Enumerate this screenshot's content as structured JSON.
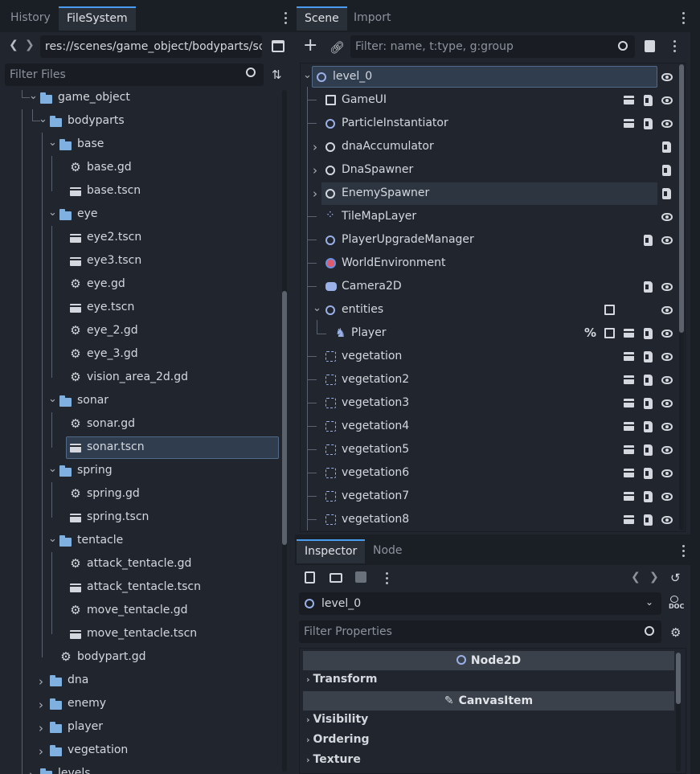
{
  "left_tabs": [
    "History",
    "FileSystem"
  ],
  "path": "res://scenes/game_object/bodyparts/so",
  "filter_files_placeholder": "Filter Files",
  "files": [
    {
      "label": "game_object",
      "type": "folder",
      "expanded": true
    },
    {
      "label": "bodyparts",
      "type": "folder",
      "expanded": true
    },
    {
      "label": "base",
      "type": "folder",
      "expanded": true
    },
    {
      "label": "base.gd",
      "type": "gd"
    },
    {
      "label": "base.tscn",
      "type": "tscn"
    },
    {
      "label": "eye",
      "type": "folder",
      "expanded": true
    },
    {
      "label": "eye2.tscn",
      "type": "tscn"
    },
    {
      "label": "eye3.tscn",
      "type": "tscn"
    },
    {
      "label": "eye.gd",
      "type": "gd"
    },
    {
      "label": "eye.tscn",
      "type": "tscn"
    },
    {
      "label": "eye_2.gd",
      "type": "gd"
    },
    {
      "label": "eye_3.gd",
      "type": "gd"
    },
    {
      "label": "vision_area_2d.gd",
      "type": "gd"
    },
    {
      "label": "sonar",
      "type": "folder",
      "expanded": true
    },
    {
      "label": "sonar.gd",
      "type": "gd"
    },
    {
      "label": "sonar.tscn",
      "type": "tscn",
      "selected": true
    },
    {
      "label": "spring",
      "type": "folder",
      "expanded": true
    },
    {
      "label": "spring.gd",
      "type": "gd"
    },
    {
      "label": "spring.tscn",
      "type": "tscn"
    },
    {
      "label": "tentacle",
      "type": "folder",
      "expanded": true
    },
    {
      "label": "attack_tentacle.gd",
      "type": "gd"
    },
    {
      "label": "attack_tentacle.tscn",
      "type": "tscn"
    },
    {
      "label": "move_tentacle.gd",
      "type": "gd"
    },
    {
      "label": "move_tentacle.tscn",
      "type": "tscn"
    },
    {
      "label": "bodypart.gd",
      "type": "gd"
    },
    {
      "label": "dna",
      "type": "folder"
    },
    {
      "label": "enemy",
      "type": "folder"
    },
    {
      "label": "player",
      "type": "folder"
    },
    {
      "label": "vegetation",
      "type": "folder"
    },
    {
      "label": "levels",
      "type": "folder"
    }
  ],
  "scene_tabs": [
    "Scene",
    "Import"
  ],
  "scene_filter_placeholder": "Filter: name, t:type, g:group",
  "scene_nodes": [
    {
      "label": "level_0",
      "icon": "node2d-icon"
    },
    {
      "label": "GameUI",
      "icon": "control-icon"
    },
    {
      "label": "ParticleInstantiator",
      "icon": "node2d-icon"
    },
    {
      "label": "dnaAccumulator",
      "icon": "node-icon"
    },
    {
      "label": "DnaSpawner",
      "icon": "node-icon"
    },
    {
      "label": "EnemySpawner",
      "icon": "node-icon"
    },
    {
      "label": "TileMapLayer",
      "icon": "tilemap-icon"
    },
    {
      "label": "PlayerUpgradeManager",
      "icon": "node2d-icon"
    },
    {
      "label": "WorldEnvironment",
      "icon": "world-environment-icon"
    },
    {
      "label": "Camera2D",
      "icon": "camera2d-icon"
    },
    {
      "label": "entities",
      "icon": "node2d-icon"
    },
    {
      "label": "Player",
      "icon": "character-body-icon"
    },
    {
      "label": "vegetation",
      "icon": "area2d-icon"
    },
    {
      "label": "vegetation2",
      "icon": "area2d-icon"
    },
    {
      "label": "vegetation3",
      "icon": "area2d-icon"
    },
    {
      "label": "vegetation4",
      "icon": "area2d-icon"
    },
    {
      "label": "vegetation5",
      "icon": "area2d-icon"
    },
    {
      "label": "vegetation6",
      "icon": "area2d-icon"
    },
    {
      "label": "vegetation7",
      "icon": "area2d-icon"
    },
    {
      "label": "vegetation8",
      "icon": "area2d-icon"
    }
  ],
  "player_badge": "%",
  "inspector_tabs": [
    "Inspector",
    "Node"
  ],
  "inspector_selected": "level_0",
  "doc_label": "DOC",
  "filter_properties_placeholder": "Filter Properties",
  "sections": [
    "Node2D",
    "CanvasItem"
  ],
  "properties": [
    "Transform",
    "Visibility",
    "Ordering",
    "Texture"
  ]
}
